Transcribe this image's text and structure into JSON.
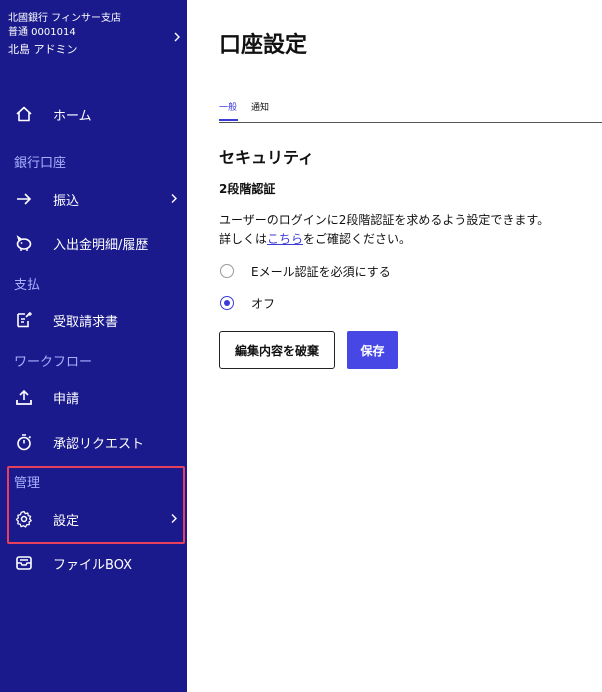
{
  "sidebar": {
    "account": {
      "bank_branch": "北國銀行 フィンサー支店",
      "account_number": "普通 0001014",
      "user_name": "北島 アドミン"
    },
    "items": {
      "home": {
        "label": "ホーム",
        "icon": "home-icon"
      },
      "section_banking": "銀行口座",
      "transfer": {
        "label": "振込",
        "icon": "arrow-right-icon"
      },
      "statement": {
        "label": "入出金明細/履歴",
        "icon": "piggy-bank-icon"
      },
      "section_payment": "支払",
      "invoices": {
        "label": "受取請求書",
        "icon": "edit-document-icon"
      },
      "section_workflow": "ワークフロー",
      "application": {
        "label": "申請",
        "icon": "upload-icon"
      },
      "approval": {
        "label": "承認リクエスト",
        "icon": "stopwatch-icon"
      },
      "section_admin": "管理",
      "settings": {
        "label": "設定",
        "icon": "gear-icon"
      },
      "filebox": {
        "label": "ファイルBOX",
        "icon": "inbox-icon"
      }
    }
  },
  "main": {
    "title": "口座設定",
    "tabs": [
      {
        "label": "一般",
        "active": true
      },
      {
        "label": "通知",
        "active": false
      }
    ],
    "security": {
      "title": "セキュリティ",
      "subtitle": "2段階認証",
      "desc_line1": "ユーザーのログインに2段階認証を求めるよう設定できます。",
      "desc_prefix": "詳しくは",
      "desc_link": "こちら",
      "desc_suffix": "をご確認ください。",
      "options": [
        {
          "label": "Eメール認証を必須にする",
          "checked": false
        },
        {
          "label": "オフ",
          "checked": true
        }
      ]
    },
    "buttons": {
      "discard": "編集内容を破棄",
      "save": "保存"
    }
  },
  "colors": {
    "sidebar_bg": "#1a1a8c",
    "accent": "#3b3bd8",
    "primary_button": "#4747e6",
    "highlight_border": "#e6405a"
  }
}
